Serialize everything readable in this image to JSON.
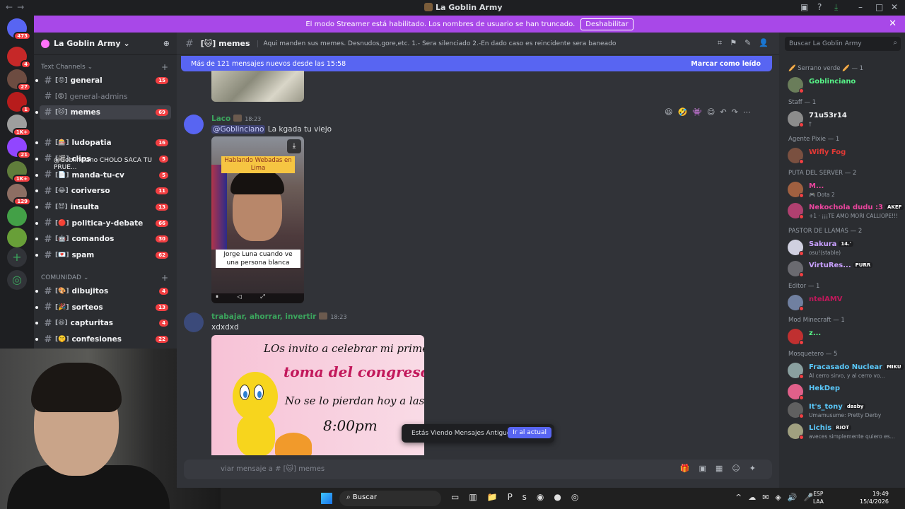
{
  "window": {
    "title": "La Goblin Army",
    "nav_back": "←",
    "nav_fwd": "→"
  },
  "banner": {
    "text": "El modo Streamer está habilitado. Los nombres de usuario se han truncado.",
    "button": "Deshabilitar",
    "close": "✕"
  },
  "servers": [
    {
      "badge": "473",
      "color": "#5865f2"
    },
    {
      "badge": "4",
      "color": "#c62828"
    },
    {
      "badge": "27",
      "color": "#6d4c41"
    },
    {
      "badge": "1",
      "color": "#b71c1c"
    },
    {
      "badge": "1K+",
      "color": "#9e9e9e"
    },
    {
      "badge": "21",
      "color": "#9146ff"
    },
    {
      "badge": "1K+",
      "color": "#607d3b"
    },
    {
      "badge": "129",
      "color": "#8d6e63"
    },
    {
      "badge": "",
      "color": "#43a047"
    },
    {
      "badge": "",
      "color": "#689f38"
    }
  ],
  "guild": {
    "name": "La Goblin Army",
    "chevron": "⌄"
  },
  "categories": {
    "text": "Text Channels",
    "community": "COMUNIDAD"
  },
  "channels": [
    {
      "name": "general",
      "emoji": "[😡]",
      "count": "15"
    },
    {
      "name": "general-admins",
      "emoji": "[😡]",
      "count": ""
    },
    {
      "name": "memes",
      "emoji": "[🐱]",
      "count": "69"
    },
    {
      "name": "ludopatia",
      "emoji": "[🎰]",
      "count": "16"
    },
    {
      "name": "clips",
      "emoji": "[🎬]",
      "count": "5"
    },
    {
      "name": "manda-tu-cv",
      "emoji": "[📄]",
      "count": "5"
    },
    {
      "name": "coriverso",
      "emoji": "[😂]",
      "count": "11"
    },
    {
      "name": "insulta",
      "emoji": "[😈]",
      "count": "13"
    },
    {
      "name": "politica-y-debate",
      "emoji": "[🔴]",
      "count": "66"
    },
    {
      "name": "comandos",
      "emoji": "[🤖]",
      "count": "30"
    },
    {
      "name": "spam",
      "emoji": "[💌]",
      "count": "62"
    }
  ],
  "thread": "@Goblinciano CHOLO SACA TU PRUE...",
  "community_channels": [
    {
      "name": "dibujitos",
      "emoji": "[🎨]",
      "count": "4"
    },
    {
      "name": "sorteos",
      "emoji": "[🎉]",
      "count": "13"
    },
    {
      "name": "capturitas",
      "emoji": "[😆]",
      "count": "4"
    },
    {
      "name": "confesiones",
      "emoji": "[🤫]",
      "count": "22"
    }
  ],
  "channel_header": {
    "name": "memes",
    "emoji": "[🐱]",
    "topic": "Aqui manden sus memes. Desnudos,gore,etc. 1.- Sera silenciado 2.-En dado caso es reincidente sera baneado",
    "search_placeholder": "Buscar La Goblin Army"
  },
  "new_messages": {
    "text": "Más de 121 mensajes nuevos desde las 15:58",
    "mark": "Marcar como leído"
  },
  "messages": [
    {
      "author": "Laco",
      "time": "18:23",
      "mention": "@Goblinciano",
      "text": "La kgada tu viejo",
      "video_caption_top": "Hablando Webadas en Lima",
      "video_caption_bottom": "Jorge Luna cuando ve una persona blanca"
    },
    {
      "author": "trabajar, ahorrar, invertir",
      "time": "18:23",
      "text": "xdxdxd",
      "image_lines": [
        "LOs invito a celebrar mi primer",
        "toma del congreso",
        "No se lo pierdan hoy a las",
        "8:00pm"
      ]
    }
  ],
  "old_messages": {
    "text": "Estás Viendo Mensajes Antiguos",
    "button": "Ir al actual"
  },
  "composer": {
    "placeholder": "viar mensaje a # [🐱] memes"
  },
  "members": [
    {
      "type": "header",
      "text": "🥖 Serrano verde 🥖 — 1"
    },
    {
      "type": "member",
      "name": "Goblinciano",
      "status": "",
      "color": "#57f287"
    },
    {
      "type": "header",
      "text": "Staff — 1"
    },
    {
      "type": "member",
      "name": "71u53r14",
      "status": "†",
      "color": "#f2f3f5"
    },
    {
      "type": "header",
      "text": "Agente Pixie — 1"
    },
    {
      "type": "member",
      "name": "Wifly Fog",
      "status": "",
      "color": "#e53935"
    },
    {
      "type": "header",
      "text": "PUTA DEL SERVER — 2"
    },
    {
      "type": "member",
      "name": "M...",
      "status": "🎮 Dota 2",
      "color": "#eb459e"
    },
    {
      "type": "member",
      "name": "Nekochola dudu :3",
      "chip": "AKEF",
      "status": "+1 · ¡¡¡TE AMO MORI CALLIOPE!!!",
      "color": "#eb459e"
    },
    {
      "type": "header",
      "text": "PASTOR DE LLAMAS — 2"
    },
    {
      "type": "member",
      "name": "Sakura",
      "chip": "14.'",
      "status": "osu!(stable)",
      "color": "#c9a0ff"
    },
    {
      "type": "member",
      "name": "VirtuRes...",
      "chip": "PURR",
      "status": "",
      "color": "#c9a0ff"
    },
    {
      "type": "header",
      "text": "Editor — 1"
    },
    {
      "type": "member",
      "name": "ntelAMV",
      "status": "",
      "color": "#c2185b"
    },
    {
      "type": "header",
      "text": "Mod Minecraft — 1"
    },
    {
      "type": "member",
      "name": "z...",
      "status": "",
      "color": "#57f287"
    },
    {
      "type": "header",
      "text": "Mosquetero — 5"
    },
    {
      "type": "member",
      "name": "Fracasado Nuclear",
      "chip": "MIKU",
      "status": "Al cerro sirvo, y al cerro vo...",
      "color": "#5ac8fa"
    },
    {
      "type": "member",
      "name": "HekDep",
      "status": "",
      "color": "#5ac8fa"
    },
    {
      "type": "member",
      "name": "It's_tony",
      "chip": "dasby",
      "status": "Umamusume: Pretty Derby",
      "color": "#5ac8fa"
    },
    {
      "type": "member",
      "name": "Lichis",
      "chip": "RIOT",
      "status": "aveces simplemente quiero es...",
      "color": "#5ac8fa"
    }
  ],
  "taskbar": {
    "search": "Buscar",
    "lang1": "ESP",
    "lang2": "LAA",
    "time": "19:49",
    "date": "15/4/2026"
  }
}
